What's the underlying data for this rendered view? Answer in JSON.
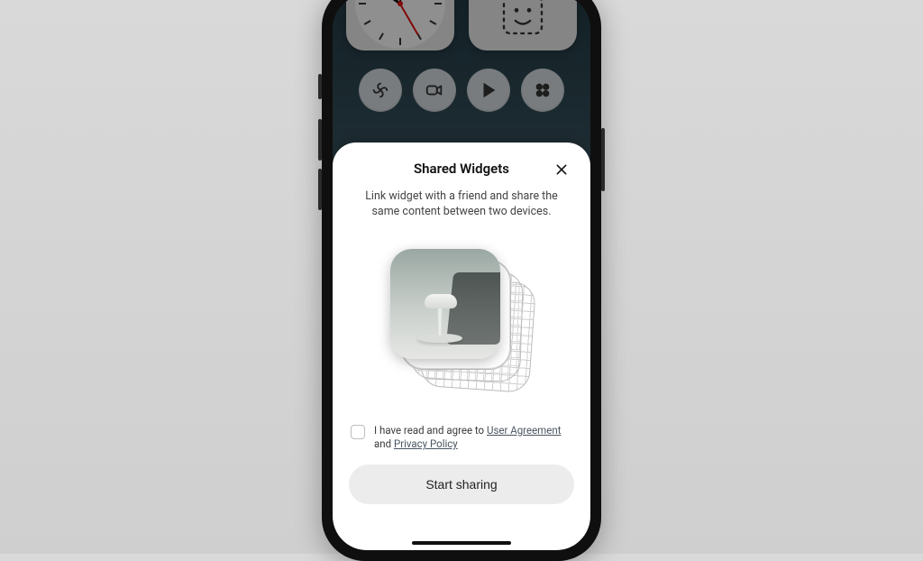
{
  "sheet": {
    "title": "Shared Widgets",
    "description": "Link widget with a friend and share the same content between two devices.",
    "consent_prefix": "I have read and agree to ",
    "consent_link_agreement": "User Agreement",
    "consent_middle": " and ",
    "consent_link_privacy": "Privacy Policy",
    "cta_label": "Start sharing"
  },
  "background_apps": {
    "chips": [
      "gallery-icon",
      "video-icon",
      "play-store-icon",
      "health-icon"
    ]
  }
}
